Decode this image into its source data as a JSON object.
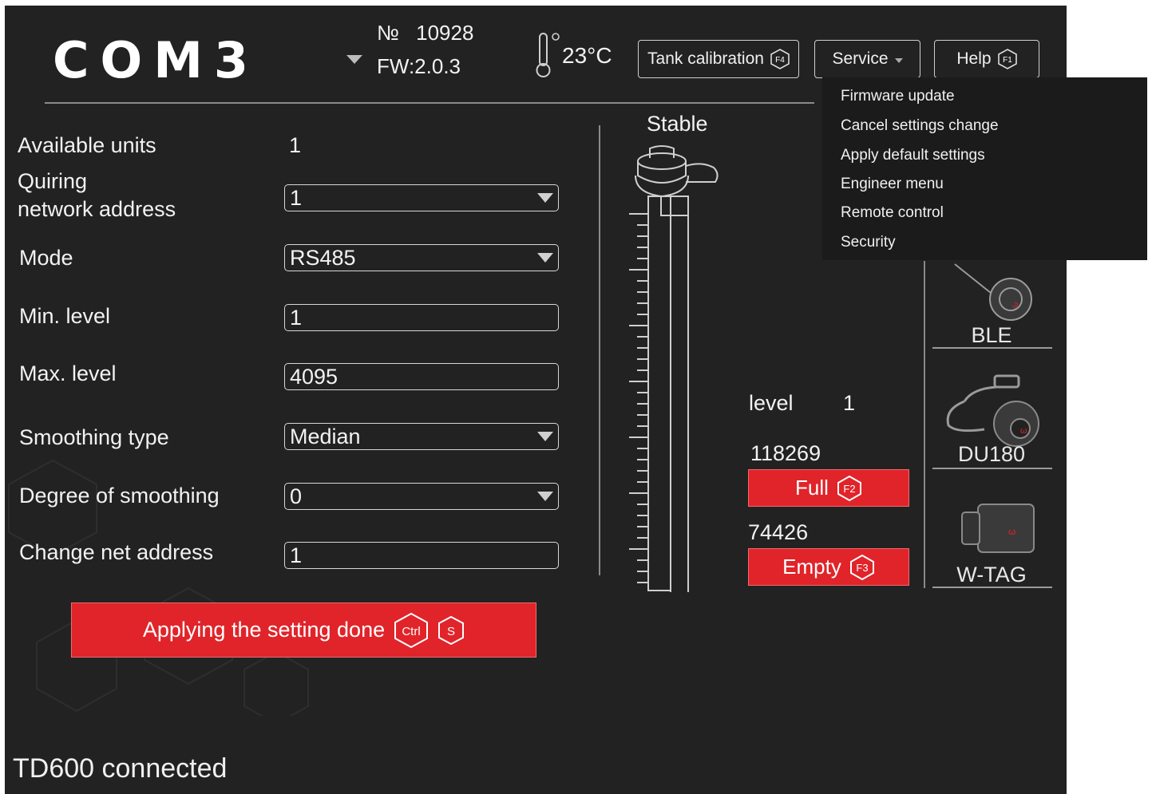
{
  "header": {
    "logo": "COM3",
    "serial_label": "№",
    "serial_value": "10928",
    "firmware": "FW:2.0.3",
    "temperature": "23°C",
    "tank_calibration_label": "Tank calibration",
    "tank_calibration_key": "F4",
    "service_label": "Service",
    "help_label": "Help",
    "help_key": "F1"
  },
  "service_menu": {
    "items": [
      {
        "label": "Firmware update"
      },
      {
        "label": "Cancel settings change"
      },
      {
        "label": "Apply default settings"
      },
      {
        "label": "Engineer menu"
      },
      {
        "label": "Remote control"
      },
      {
        "label": "Security"
      }
    ]
  },
  "settings": {
    "available_units_label": "Available units",
    "available_units_value": "1",
    "quiring_label_line1": "Quiring",
    "quiring_label_line2": "network address",
    "quiring_value": "1",
    "mode_label": "Mode",
    "mode_value": "RS485",
    "min_level_label": "Min. level",
    "min_level_value": "1",
    "max_level_label": "Max. level",
    "max_level_value": "4095",
    "smoothing_type_label": "Smoothing type",
    "smoothing_type_value": "Median",
    "degree_label": "Degree of smoothing",
    "degree_value": "0",
    "change_net_label": "Change net address",
    "change_net_value": "1"
  },
  "apply_button": {
    "label": "Applying the setting done",
    "key1": "Ctrl",
    "key2": "S"
  },
  "sensor": {
    "status": "Stable",
    "level_label": "level",
    "level_value": "1",
    "full_value": "118269",
    "full_label": "Full",
    "full_key": "F2",
    "empty_value": "74426",
    "empty_label": "Empty",
    "empty_key": "F3"
  },
  "devices": [
    {
      "label": "BLE"
    },
    {
      "label": "DU180"
    },
    {
      "label": "W-TAG"
    }
  ],
  "status_bar": {
    "text": "TD600 connected"
  },
  "colors": {
    "background": "#222222",
    "accent_red": "#e0242a",
    "menu_bg": "#1b1b1b"
  }
}
